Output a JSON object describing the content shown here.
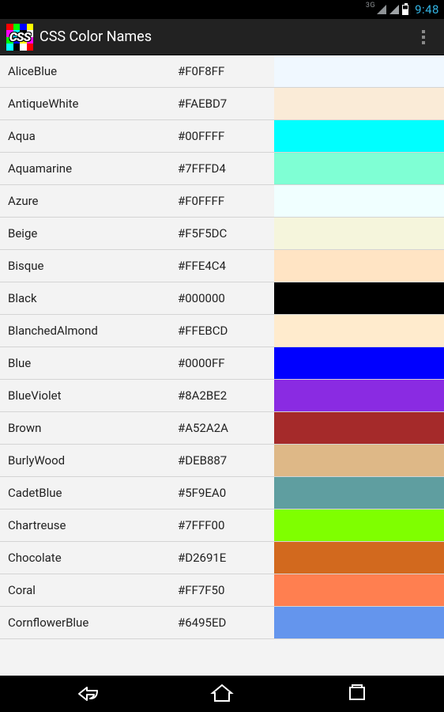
{
  "status": {
    "net_label": "3G",
    "clock": "9:48"
  },
  "header": {
    "logo_text": "CSS",
    "title": "CSS Color Names"
  },
  "colors": [
    {
      "name": "AliceBlue",
      "hex": "#F0F8FF",
      "swatch": "#F0F8FF"
    },
    {
      "name": "AntiqueWhite",
      "hex": "#FAEBD7",
      "swatch": "#FAEBD7"
    },
    {
      "name": "Aqua",
      "hex": "#00FFFF",
      "swatch": "#00FFFF"
    },
    {
      "name": "Aquamarine",
      "hex": "#7FFFD4",
      "swatch": "#7FFFD4"
    },
    {
      "name": "Azure",
      "hex": "#F0FFFF",
      "swatch": "#F0FFFF"
    },
    {
      "name": "Beige",
      "hex": "#F5F5DC",
      "swatch": "#F5F5DC"
    },
    {
      "name": "Bisque",
      "hex": "#FFE4C4",
      "swatch": "#FFE4C4"
    },
    {
      "name": "Black",
      "hex": "#000000",
      "swatch": "#000000"
    },
    {
      "name": "BlanchedAlmond",
      "hex": "#FFEBCD",
      "swatch": "#FFEBCD"
    },
    {
      "name": "Blue",
      "hex": "#0000FF",
      "swatch": "#0000FF"
    },
    {
      "name": "BlueViolet",
      "hex": "#8A2BE2",
      "swatch": "#8A2BE2"
    },
    {
      "name": "Brown",
      "hex": "#A52A2A",
      "swatch": "#A52A2A"
    },
    {
      "name": "BurlyWood",
      "hex": "#DEB887",
      "swatch": "#DEB887"
    },
    {
      "name": "CadetBlue",
      "hex": "#5F9EA0",
      "swatch": "#5F9EA0"
    },
    {
      "name": "Chartreuse",
      "hex": "#7FFF00",
      "swatch": "#7FFF00"
    },
    {
      "name": "Chocolate",
      "hex": "#D2691E",
      "swatch": "#D2691E"
    },
    {
      "name": "Coral",
      "hex": "#FF7F50",
      "swatch": "#FF7F50"
    },
    {
      "name": "CornflowerBlue",
      "hex": "#6495ED",
      "swatch": "#6495ED"
    }
  ]
}
